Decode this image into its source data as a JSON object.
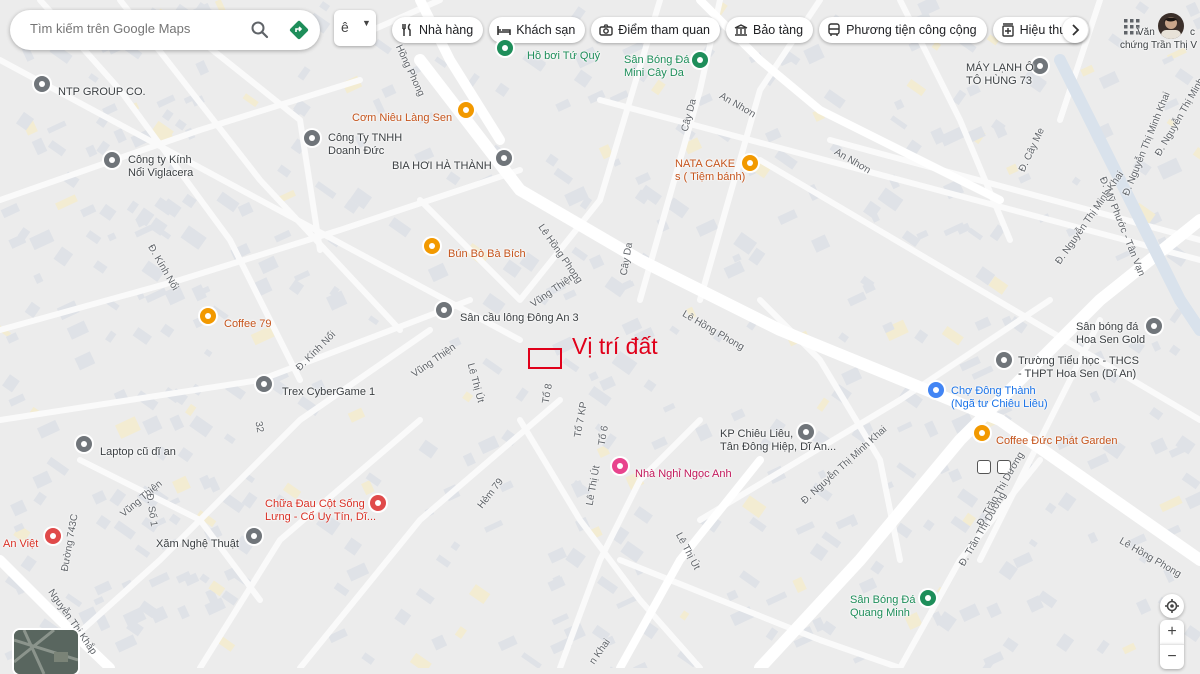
{
  "search": {
    "placeholder": "Tìm kiếm trên Google Maps"
  },
  "layers_button": {
    "label": "ê"
  },
  "chips": [
    {
      "label": "Nhà hàng",
      "icon": "fork-knife-icon"
    },
    {
      "label": "Khách sạn",
      "icon": "bed-icon"
    },
    {
      "label": "Điểm tham quan",
      "icon": "camera-icon"
    },
    {
      "label": "Bảo tàng",
      "icon": "museum-icon"
    },
    {
      "label": "Phương tiện công cộng",
      "icon": "bus-icon"
    },
    {
      "label": "Hiệu thuốc",
      "icon": "pharmacy-icon"
    }
  ],
  "top_right_text": {
    "line1": "Văn",
    "line1b": "c",
    "line2": "chứng Trần Thị V"
  },
  "annotation": {
    "text": "Vị trí đất"
  },
  "pois": [
    {
      "name": "Hồ bơi Tứ Quý",
      "color": "green"
    },
    {
      "name": "Sân Bóng Đá\nMini Cây Da",
      "color": "green"
    },
    {
      "name": "MÁY LẠNH Ô\nTÔ HÙNG 73",
      "color": "grey"
    },
    {
      "name": "NTP GROUP CO.",
      "color": "grey"
    },
    {
      "name": "Cơm Niêu Làng Sen",
      "color": "orange"
    },
    {
      "name": "Công Ty TNHH\nDoanh Đức",
      "color": "grey"
    },
    {
      "name": "Công ty Kính\nNổi Viglacera",
      "color": "grey"
    },
    {
      "name": "BIA HƠI HÀ THÀNH",
      "color": "grey"
    },
    {
      "name": "NATA CAKE\ns ( Tiệm bánh)",
      "color": "orange"
    },
    {
      "name": "Bún Bò Bà Bích",
      "color": "orange"
    },
    {
      "name": "Coffee 79",
      "color": "orange"
    },
    {
      "name": "Sân cầu lông Đông An 3",
      "color": "grey"
    },
    {
      "name": "Sân bóng đá\nHoa Sen Gold",
      "color": "grey"
    },
    {
      "name": "Trường Tiểu học - THCS\n- THPT Hoa Sen (Dĩ An)",
      "color": "grey"
    },
    {
      "name": "Trex CyberGame 1",
      "color": "grey"
    },
    {
      "name": "Chợ Đông Thành\n(Ngã tư Chiêu Liêu)",
      "color": "blue"
    },
    {
      "name": "KP Chiêu Liêu,\nTân Đông Hiệp, Dĩ An...",
      "color": "grey"
    },
    {
      "name": "Coffee Đức Phát Garden",
      "color": "orange"
    },
    {
      "name": "Laptop cũ dĩ an",
      "color": "grey"
    },
    {
      "name": "Nhà Nghỉ Ngọc Anh",
      "color": "pink"
    },
    {
      "name": "Chữa Đau Cột Sống\nLưng - Cổ Uy Tín, Dĩ...",
      "color": "red"
    },
    {
      "name": "An Việt",
      "color": "red"
    },
    {
      "name": "Xăm Nghệ Thuật",
      "color": "grey"
    },
    {
      "name": "Sân Bóng Đá\nQuang Minh",
      "color": "green"
    }
  ],
  "streets": [
    "Hồng Phong",
    "An Nhơn",
    "An Nhơn",
    "Cây Da",
    "Cây Da",
    "Lê Hồng Phong",
    "Lê Hồng Phong",
    "Lê Hồng Phong",
    "Vũng Thiện",
    "Vũng Thiện",
    "Vũng Thiện",
    "Lê Thị Út",
    "Lê Thị Út",
    "Lê Thị Út",
    "Tổ 8",
    "Tổ 7 KP",
    "Tổ 6",
    "Hẻm 79",
    "Đ. Kính Nổi",
    "Đ. Kính Nổi",
    "32",
    "Đường 743C",
    "Đ. Số 1",
    "Nguyễn Thị Khắp",
    "Đ. Nguyễn Thị Minh Khai",
    "Đ. Nguyễn Thị Minh Khai",
    "Đ. Nguyễn Thị Minh Khai",
    "Đ. Mỹ Phước - Tân Vạn",
    "Đ. Cây Me",
    "Đ. Trần Thị Dương",
    "Đ. Trần Thị Dương",
    "n Khai",
    "Đ. Nguyễn Thị Minh"
  ],
  "map_controls": {
    "zoom_in": "+",
    "zoom_out": "−"
  }
}
